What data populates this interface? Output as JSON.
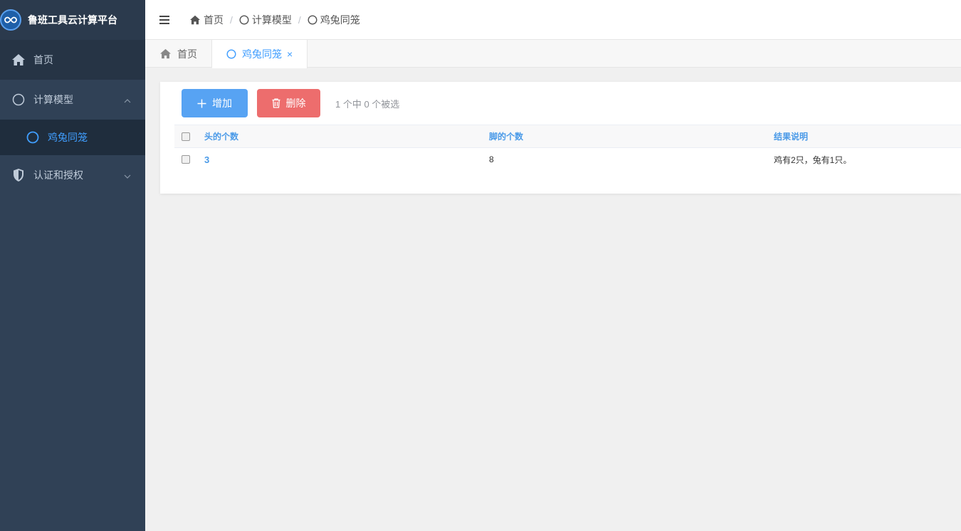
{
  "app": {
    "title": "鲁班工具云计算平台"
  },
  "sidebar": {
    "items": [
      {
        "label": "首页",
        "icon": "home-icon"
      },
      {
        "label": "计算模型",
        "icon": "circle-icon",
        "expanded": true,
        "children": [
          {
            "label": "鸡兔同笼",
            "icon": "circle-icon",
            "active": true
          }
        ]
      },
      {
        "label": "认证和授权",
        "icon": "shield-icon",
        "expanded": false
      }
    ]
  },
  "navbar": {
    "breadcrumb": [
      {
        "label": "首页",
        "icon": "home-icon"
      },
      {
        "label": "计算模型",
        "icon": "circle-icon"
      },
      {
        "label": "鸡兔同笼",
        "icon": "circle-icon"
      }
    ]
  },
  "tabs": [
    {
      "label": "首页",
      "icon": "home-icon",
      "active": false
    },
    {
      "label": "鸡兔同笼",
      "icon": "circle-icon",
      "active": true,
      "close": "×"
    }
  ],
  "toolbar": {
    "add_label": "增加",
    "delete_label": "删除",
    "selection_info": "1 个中 0 个被选"
  },
  "table": {
    "columns": [
      "头的个数",
      "脚的个数",
      "结果说明"
    ],
    "rows": [
      [
        "3",
        "8",
        "鸡有2只，兔有1只。"
      ]
    ]
  },
  "colors": {
    "sidebar_bg": "#304156",
    "accent": "#409eff",
    "add_button": "#57a3f3",
    "delete_button": "#ed6d6d"
  }
}
